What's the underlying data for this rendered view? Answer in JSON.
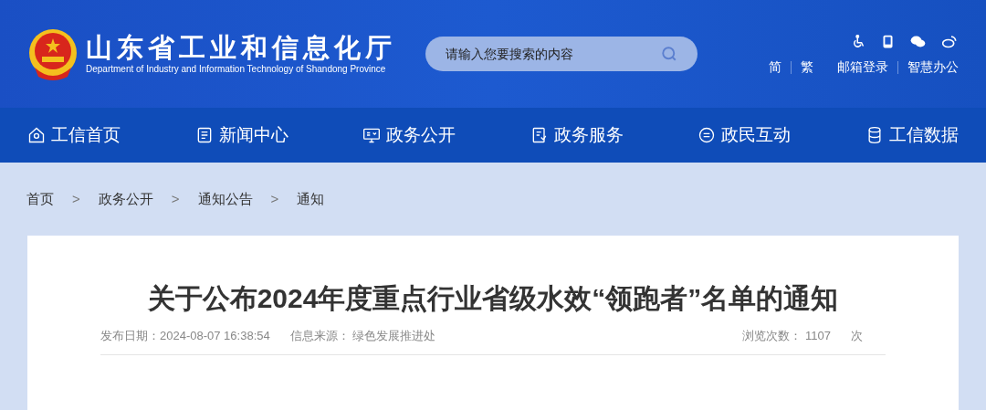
{
  "header": {
    "title": "山东省工业和信息化厅",
    "subtitle": "Department of Industry and Information Technology of Shandong Province",
    "search": {
      "placeholder": "请输入您要搜索的内容"
    },
    "links": [
      {
        "label": "简"
      },
      {
        "label": "繁"
      },
      {
        "label": "邮箱登录"
      },
      {
        "label": "智慧办公"
      }
    ]
  },
  "nav": [
    {
      "label": "工信首页"
    },
    {
      "label": "新闻中心"
    },
    {
      "label": "政务公开"
    },
    {
      "label": "政务服务"
    },
    {
      "label": "政民互动"
    },
    {
      "label": "工信数据"
    }
  ],
  "breadcrumb": [
    "首页",
    "政务公开",
    "通知公告",
    "通知"
  ],
  "breadcrumb_separator": ">",
  "article": {
    "title": "关于公布2024年度重点行业省级水效“领跑者”名单的通知",
    "date_label": "发布日期：",
    "date": "2024-08-07 16:38:54",
    "source_label": "信息来源：",
    "source": "绿色发展推进处",
    "views_label": "浏览次数：",
    "views": "1107",
    "views_unit": "次"
  }
}
